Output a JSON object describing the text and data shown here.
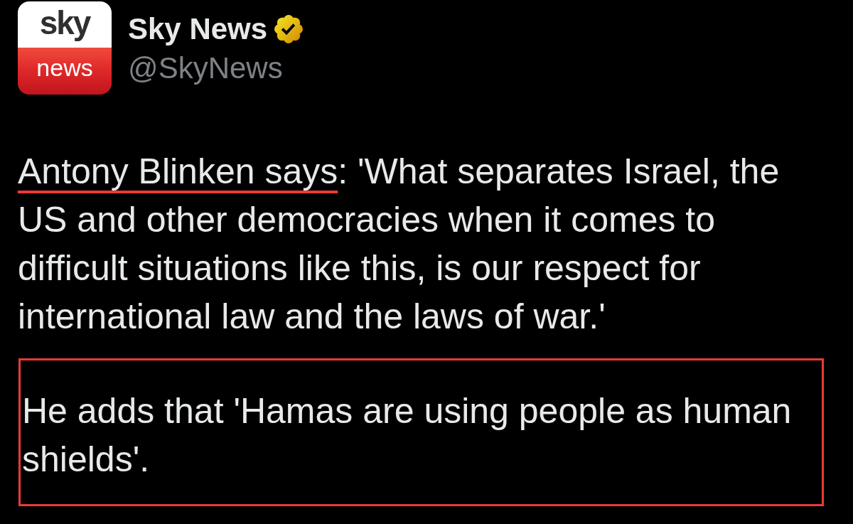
{
  "post": {
    "author": {
      "avatar": {
        "top_text": "sky",
        "bottom_text": "news"
      },
      "name": "Sky News",
      "verified": true,
      "handle": "@SkyNews"
    },
    "paragraphs": [
      {
        "segments": [
          {
            "text": "Antony Blinken says",
            "underlined": true
          },
          {
            "text": ": 'What separates Israel, the US and other democracies when it comes to difficult situations like this, is our respect for international law and the laws of war.'",
            "underlined": false
          }
        ],
        "boxed": false
      },
      {
        "segments": [
          {
            "text": "He adds that 'Hamas are using people as human shields'.",
            "underlined": false
          }
        ],
        "boxed": true
      }
    ]
  }
}
